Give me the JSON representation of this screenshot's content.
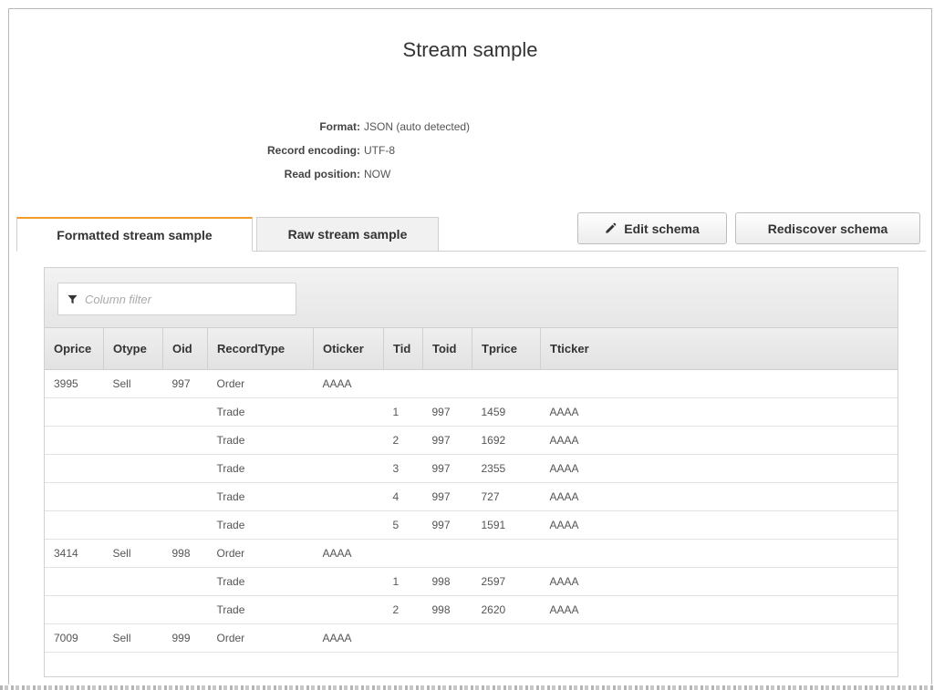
{
  "title": "Stream sample",
  "meta": [
    {
      "label": "Format:",
      "value": "JSON (auto detected)"
    },
    {
      "label": "Record encoding:",
      "value": "UTF-8"
    },
    {
      "label": "Read position:",
      "value": "NOW"
    }
  ],
  "tabs": [
    {
      "label": "Formatted stream sample",
      "active": true
    },
    {
      "label": "Raw stream sample",
      "active": false
    }
  ],
  "buttons": {
    "edit_schema": "Edit schema",
    "rediscover_schema": "Rediscover schema"
  },
  "filter": {
    "placeholder": "Column filter"
  },
  "table": {
    "columns": [
      "Oprice",
      "Otype",
      "Oid",
      "RecordType",
      "Oticker",
      "Tid",
      "Toid",
      "Tprice",
      "Tticker"
    ],
    "rows": [
      [
        "3995",
        "Sell",
        "997",
        "Order",
        "AAAA",
        "",
        "",
        "",
        ""
      ],
      [
        "",
        "",
        "",
        "Trade",
        "",
        "1",
        "997",
        "1459",
        "AAAA"
      ],
      [
        "",
        "",
        "",
        "Trade",
        "",
        "2",
        "997",
        "1692",
        "AAAA"
      ],
      [
        "",
        "",
        "",
        "Trade",
        "",
        "3",
        "997",
        "2355",
        "AAAA"
      ],
      [
        "",
        "",
        "",
        "Trade",
        "",
        "4",
        "997",
        "727",
        "AAAA"
      ],
      [
        "",
        "",
        "",
        "Trade",
        "",
        "5",
        "997",
        "1591",
        "AAAA"
      ],
      [
        "3414",
        "Sell",
        "998",
        "Order",
        "AAAA",
        "",
        "",
        "",
        ""
      ],
      [
        "",
        "",
        "",
        "Trade",
        "",
        "1",
        "998",
        "2597",
        "AAAA"
      ],
      [
        "",
        "",
        "",
        "Trade",
        "",
        "2",
        "998",
        "2620",
        "AAAA"
      ],
      [
        "7009",
        "Sell",
        "999",
        "Order",
        "AAAA",
        "",
        "",
        "",
        ""
      ]
    ]
  },
  "icons": {
    "edit": "pencil-icon",
    "filter": "filter-icon"
  },
  "colors": {
    "active_tab_accent": "#f29b29"
  }
}
